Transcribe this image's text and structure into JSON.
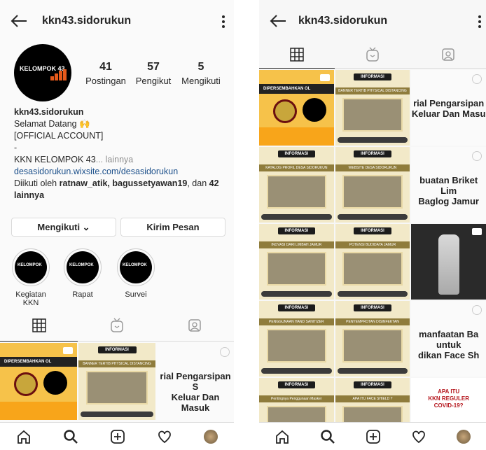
{
  "left": {
    "username": "kkn43.sidorukun",
    "avatar_logo": "KELOMPOK 43",
    "stats": [
      {
        "value": "41",
        "label": "Postingan"
      },
      {
        "value": "57",
        "label": "Pengikut"
      },
      {
        "value": "5",
        "label": "Mengikuti"
      }
    ],
    "bio": {
      "name": "kkn43.sidorukun",
      "line1": "Selamat Datang 🙌",
      "line2": "[OFFICIAL ACCOUNT]",
      "line3": "-",
      "line4": "KKN KELOMPOK 43",
      "more": "... lainnya",
      "link": "desasidorukun.wixsite.com/desasidorukun",
      "followed_prefix": "Diikuti oleh ",
      "followed_users": "ratnaw_atik, bagussetyawan19",
      "followed_mid": ", dan ",
      "followed_count": "42",
      "followed_suffix": "lainnya"
    },
    "buttons": {
      "following": "Mengikuti ⌄",
      "message": "Kirim Pesan"
    },
    "highlights": [
      {
        "label": "Kegiatan KKN"
      },
      {
        "label": "Rapat"
      },
      {
        "label": "Survei"
      }
    ],
    "posts": [
      {
        "type": "first",
        "band": "DIPERSEMBAHKAN OL"
      },
      {
        "type": "info",
        "header": "INFORMASI",
        "title": "BANNER TERTIB PHYSICAL DISTANCING"
      },
      {
        "type": "text",
        "text": "rial Pengarsipan S\nKeluar Dan Masuk"
      }
    ]
  },
  "right": {
    "username": "kkn43.sidorukun",
    "posts": [
      {
        "type": "first",
        "band": "DIPERSEMBAHKAN OL"
      },
      {
        "type": "info",
        "header": "INFORMASI",
        "title": "BANNER TERTIB PHYSICAL DISTANCING"
      },
      {
        "type": "text",
        "text": "rial Pengarsipan\nKeluar Dan Masu"
      },
      {
        "type": "info",
        "header": "INFORMASI",
        "title": "KATALOG PROFIL DESA SIDORUKUN"
      },
      {
        "type": "info",
        "header": "INFORMASI",
        "title": "WEBSITE DESA SIDORUKUN"
      },
      {
        "type": "text",
        "text": "buatan Briket Lim\nBaglog Jamur"
      },
      {
        "type": "info",
        "header": "INFORMASI",
        "title": "INOVASI DARI LIMBAH JAMUR"
      },
      {
        "type": "info",
        "header": "INFORMASI",
        "title": "POTENSI BUDIDAYA JAMUR"
      },
      {
        "type": "bottle"
      },
      {
        "type": "info",
        "header": "INFORMASI",
        "title": "PENGGUNAAN HAND SANITIZER"
      },
      {
        "type": "info",
        "header": "INFORMASI",
        "title": "PENYEMPROTAN DISINFEKTAN"
      },
      {
        "type": "text",
        "text": "manfaatan Ba\nuntuk\ndikan Face Sh"
      },
      {
        "type": "info",
        "header": "INFORMASI",
        "title": "Pentingnya Penggunaan Masker"
      },
      {
        "type": "info",
        "header": "INFORMASI",
        "title": "APA ITU FACE SHIELD ?"
      },
      {
        "type": "apa",
        "text": "APA ITU\nKKN REGULER\nCOVID-19?"
      }
    ]
  }
}
